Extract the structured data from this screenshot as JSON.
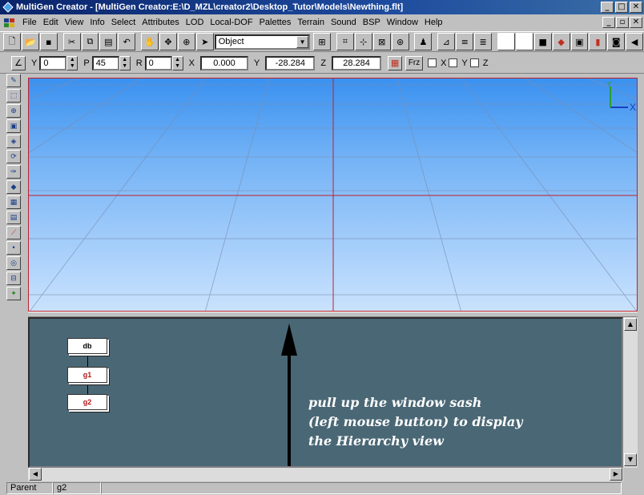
{
  "window": {
    "title": "MultiGen Creator - [MultiGen Creator:E:\\D_MZL\\creator2\\Desktop_Tutor\\Models\\Newthing.flt]",
    "caption_buttons": [
      "_",
      "□",
      "✕"
    ],
    "mdi_buttons": [
      "_",
      "▫",
      "✕"
    ]
  },
  "menu": [
    "File",
    "Edit",
    "View",
    "Info",
    "Select",
    "Attributes",
    "LOD",
    "Local-DOF",
    "Palettes",
    "Terrain",
    "Sound",
    "BSP",
    "Window",
    "Help"
  ],
  "toolbar": {
    "select_value": "Object"
  },
  "coords": {
    "y_label": "Y",
    "y_value": "0",
    "p_label": "P",
    "p_value": "45",
    "r_label": "R",
    "r_value": "0",
    "x_label": "X",
    "x_value": "0.000",
    "y2_label": "Y",
    "y2_value": "-28.284",
    "z_label": "Z",
    "z_value": "28.284",
    "frz_label": "Frz",
    "check_x": "X",
    "check_y": "Y",
    "check_z": "Z"
  },
  "axes": {
    "y": "Y",
    "x": "X"
  },
  "hierarchy": {
    "nodes": [
      "db",
      "g1",
      "g2"
    ]
  },
  "annotation": {
    "line1": "pull up the window sash",
    "line2": "(left mouse button) to display",
    "line3": "the Hierarchy view"
  },
  "status": {
    "label": "Parent",
    "value": "g2"
  },
  "colors": {
    "title_bar": "#0a246a",
    "grid_line": "#c0202a",
    "hierarchy_bg": "#4a6775",
    "node_text": "#b01818"
  }
}
